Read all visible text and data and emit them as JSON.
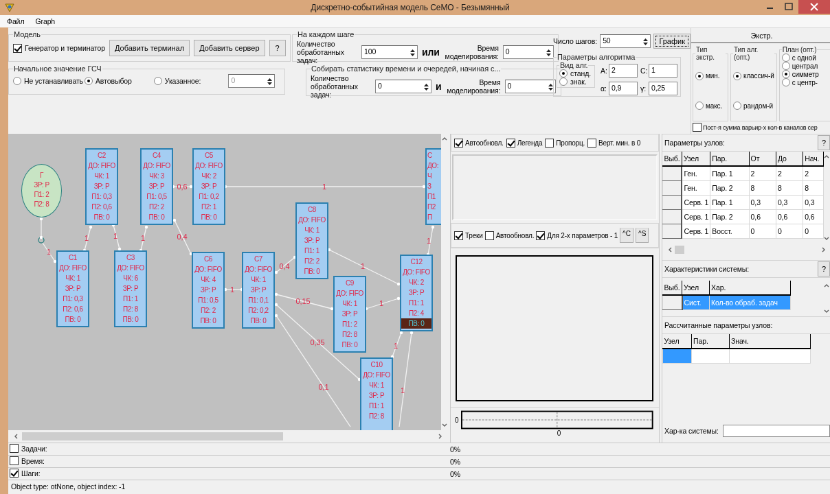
{
  "window": {
    "title": "Дискретно-событийная модель СеМО - Безымянный"
  },
  "menu": [
    {
      "label": "Файл"
    },
    {
      "label": "Graph"
    }
  ],
  "model_group": {
    "title": "Модель",
    "generator": {
      "label": "Генератор и терминатор",
      "checked": true
    },
    "buttons": [
      "Добавить терминал",
      "Добавить сервер",
      "?"
    ]
  },
  "seed_group": {
    "title": "Начальное значение ГСЧ",
    "options": [
      {
        "label": "Не устанавливать",
        "selected": false
      },
      {
        "label": "Автовыбор",
        "selected": true
      },
      {
        "label": "Указанное:",
        "selected": false
      }
    ],
    "value": "0",
    "disabled": true
  },
  "step_group": {
    "title": "На каждом шаге",
    "count_label": "Количество обработанных задач:",
    "count_value": "100",
    "joiner": "или",
    "time_label": "Время моделирования:",
    "time_value": "0"
  },
  "stats_group": {
    "title": "Собирать статистику времени и очередей, начиная с...",
    "count_label": "Количество обработанных задач:",
    "count_value": "0",
    "joiner": "и",
    "time_label": "Время моделирования:",
    "time_value": "0"
  },
  "steps": {
    "label": "Число шагов:",
    "value": "50"
  },
  "graph_button": "График",
  "algo_group": {
    "title": "Параметры алгоритма",
    "kind_group": {
      "title": "Вид алг.",
      "options": [
        {
          "label": "станд.",
          "selected": true
        },
        {
          "label": "знак.",
          "selected": false
        }
      ]
    },
    "fields": [
      {
        "label": "A:",
        "value": "2"
      },
      {
        "label": "C:",
        "value": "1"
      },
      {
        "label": "α:",
        "value": "0,9"
      },
      {
        "label": "γ:",
        "value": "0,25"
      }
    ]
  },
  "extr_panel": {
    "title": "Экстр.",
    "groups": [
      {
        "title": "Тип экстр.",
        "options": [
          {
            "label": "мин.",
            "selected": true
          },
          {
            "label": "макс.",
            "selected": false
          }
        ]
      },
      {
        "title": "Тип алг. (опт.)",
        "options": [
          {
            "label": "классич-й",
            "selected": true
          },
          {
            "label": "рандом-й",
            "selected": false
          }
        ]
      },
      {
        "title": "План (опт.)",
        "options": [
          {
            "label": "с одной",
            "selected": false
          },
          {
            "label": "централ",
            "selected": false
          },
          {
            "label": "симметр",
            "selected": true
          },
          {
            "label": "с центр-",
            "selected": false
          }
        ]
      }
    ],
    "checkbox": {
      "label": "Пост-я сумма варьир-х кол-в каналов сер",
      "checked": false
    }
  },
  "diagram": {
    "nodes": [
      {
        "kind": "generator",
        "lines": [
          "Г",
          "ЗР: Р",
          "П1: 2",
          "П2: 8"
        ]
      },
      {
        "kind": "server",
        "lines": [
          "С1",
          "ДО: FIFO",
          "ЧК: 1",
          "ЗР: Р",
          "П1: 0,3",
          "П2: 0,6",
          "ПВ: 0"
        ],
        "highlighted": false
      },
      {
        "kind": "server",
        "lines": [
          "С2",
          "ДО: FIFO",
          "ЧК: 1",
          "ЗР: Р",
          "П1: 0,3",
          "П2: 0,6",
          "ПВ: 0"
        ],
        "highlighted": false
      },
      {
        "kind": "server",
        "lines": [
          "С3",
          "ДО: FIFO",
          "ЧК: 6",
          "ЗР: Р",
          "П1: 1",
          "П2: 8",
          "ПВ: 0"
        ],
        "highlighted": false
      },
      {
        "kind": "server",
        "lines": [
          "С4",
          "ДО: FIFO",
          "ЧК: 3",
          "ЗР: Р",
          "П1: 0,5",
          "П2: 2",
          "ПВ: 0"
        ],
        "highlighted": false
      },
      {
        "kind": "server",
        "lines": [
          "С5",
          "ДО: FIFO",
          "ЧК: 2",
          "ЗР: Р",
          "П1: 0,2",
          "П2: 1",
          "ПВ: 0"
        ],
        "highlighted": false
      },
      {
        "kind": "server",
        "lines": [
          "С6",
          "ДО: FIFO",
          "ЧК: 4",
          "ЗР: Р",
          "П1: 0,5",
          "П2: 2",
          "ПВ: 0"
        ],
        "highlighted": false
      },
      {
        "kind": "server",
        "lines": [
          "С7",
          "ДО: FIFO",
          "ЧК: 1",
          "ЗР: Р",
          "П1: 0,1",
          "П2: 0,2",
          "ПВ: 0"
        ],
        "highlighted": false
      },
      {
        "kind": "server",
        "lines": [
          "С8",
          "ДО: FIFO",
          "ЧК: 1",
          "ЗР: Р",
          "П1: 1",
          "П2: 2",
          "ПВ: 0"
        ],
        "highlighted": false
      },
      {
        "kind": "server",
        "lines": [
          "С9",
          "ДО: FIFO",
          "ЧК: 1",
          "ЗР: Р",
          "П1: 2",
          "П2: 8",
          "ПВ: 0"
        ],
        "highlighted": false
      },
      {
        "kind": "server",
        "lines": [
          "С10",
          "ДО: FIFO",
          "ЧК: 1",
          "ЗР: Р",
          "П1: 1",
          "П2: 8"
        ],
        "highlighted": false
      },
      {
        "kind": "server",
        "lines": [
          "С",
          "ДО:",
          "Ч",
          "З",
          "П1",
          "П2",
          "П"
        ],
        "highlighted": false
      },
      {
        "kind": "server",
        "lines": [
          "С12",
          "ДО: FIFO",
          "ЧК: 2",
          "ЗР: Р",
          "П1: 1",
          "П2: 4",
          "ПВ: 0"
        ],
        "highlighted": true
      }
    ],
    "edges": [
      {
        "label": "1"
      },
      {
        "label": "1"
      },
      {
        "label": "1"
      },
      {
        "label": "1"
      },
      {
        "label": "0,6"
      },
      {
        "label": "0,4"
      },
      {
        "label": "1"
      },
      {
        "label": "1"
      },
      {
        "label": "0,4"
      },
      {
        "label": "0,15"
      },
      {
        "label": "0,35"
      },
      {
        "label": "0,1"
      },
      {
        "label": "1"
      },
      {
        "label": "1"
      },
      {
        "label": "1"
      },
      {
        "label": "1"
      },
      {
        "label": "1"
      }
    ]
  },
  "chart_panel": {
    "options": [
      {
        "label": "Автообновл.",
        "checked": true
      },
      {
        "label": "Легенда",
        "checked": true
      },
      {
        "label": "Пропорц.",
        "checked": false
      },
      {
        "label": "Верт. мин. в 0",
        "checked": false
      }
    ],
    "track_options": [
      {
        "label": "Треки",
        "checked": true
      },
      {
        "label": "Автообновл.",
        "checked": false
      },
      {
        "label": "Для 2-х параметров - 1",
        "checked": true
      }
    ],
    "buttons": [
      "^C",
      "^S"
    ],
    "mini_plot": {
      "y_label": "0",
      "x_label": "0"
    }
  },
  "node_params": {
    "title": "Параметры узлов:",
    "help": "?",
    "columns": [
      "Выб.",
      "Узел",
      "Пар.",
      "От",
      "До",
      "Нач."
    ],
    "rows": [
      {
        "cells": [
          "",
          "Ген.",
          "Пар. 1",
          "2",
          "2",
          "2"
        ]
      },
      {
        "cells": [
          "",
          "Ген.",
          "Пар. 2",
          "8",
          "8",
          "8"
        ]
      },
      {
        "cells": [
          "",
          "Серв. 1",
          "Пар. 1",
          "0,3",
          "0,3",
          "0,3"
        ]
      },
      {
        "cells": [
          "",
          "Серв. 1",
          "Пар. 2",
          "0,6",
          "0,6",
          "0,6"
        ]
      },
      {
        "cells": [
          "",
          "Серв. 1",
          "Восст.",
          "0",
          "0",
          "0"
        ]
      }
    ]
  },
  "system_chars": {
    "title": "Характеристики системы:",
    "help": "?",
    "columns": [
      "Выб.",
      "Узел",
      "Хар."
    ],
    "rows": [
      {
        "cells": [
          "",
          "Сист.",
          "Кол-во обраб. задач"
        ],
        "selected": true
      }
    ]
  },
  "computed_params": {
    "title": "Рассчитанные параметры узлов:",
    "columns": [
      "Узел",
      "Пар.",
      "Знач."
    ],
    "rows": [
      {
        "selected": true
      }
    ]
  },
  "system_field": {
    "label": "Хар-ка системы:"
  },
  "progress": [
    {
      "label": "Задачи:",
      "checked": false,
      "value": "0%"
    },
    {
      "label": "Время:",
      "checked": false,
      "value": "0%"
    },
    {
      "label": "Шаги:",
      "checked": true,
      "value": "0%"
    }
  ],
  "status_bar": "Object type: otNone, object index: -1"
}
